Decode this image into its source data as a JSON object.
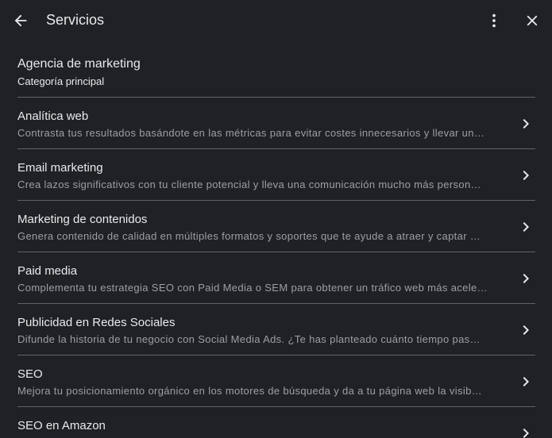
{
  "header": {
    "title": "Servicios",
    "back_icon": "arrow-back-icon",
    "more_icon": "more-vert-icon",
    "close_icon": "close-icon"
  },
  "primary_category": {
    "name": "Agencia de marketing",
    "label": "Categoría principal"
  },
  "services": [
    {
      "name": "Analítica web",
      "description": "Contrasta tus resultados basándote en las métricas para evitar costes innecesarios y llevar un…"
    },
    {
      "name": "Email marketing",
      "description": "Crea lazos significativos con tu cliente potencial y lleva una comunicación mucho más person…"
    },
    {
      "name": "Marketing de contenidos",
      "description": "Genera contenido de calidad en múltiples formatos y soportes que te ayude a atraer y captar …"
    },
    {
      "name": "Paid media",
      "description": "Complementa tu estrategia SEO con Paid Media o SEM para obtener un tráfico web más acele…"
    },
    {
      "name": "Publicidad en Redes Sociales",
      "description": "Difunde la historia de tu negocio con Social Media Ads. ¿Te has planteado cuánto tiempo pas…"
    },
    {
      "name": "SEO",
      "description": "Mejora tu posicionamiento orgánico en los motores de búsqueda y da a tu página web la visib…"
    },
    {
      "name": "SEO en Amazon",
      "description": ""
    }
  ],
  "colors": {
    "background": "#202124",
    "text_primary": "#e8eaed",
    "text_secondary": "#9aa0a6",
    "divider": "#5f6368"
  }
}
